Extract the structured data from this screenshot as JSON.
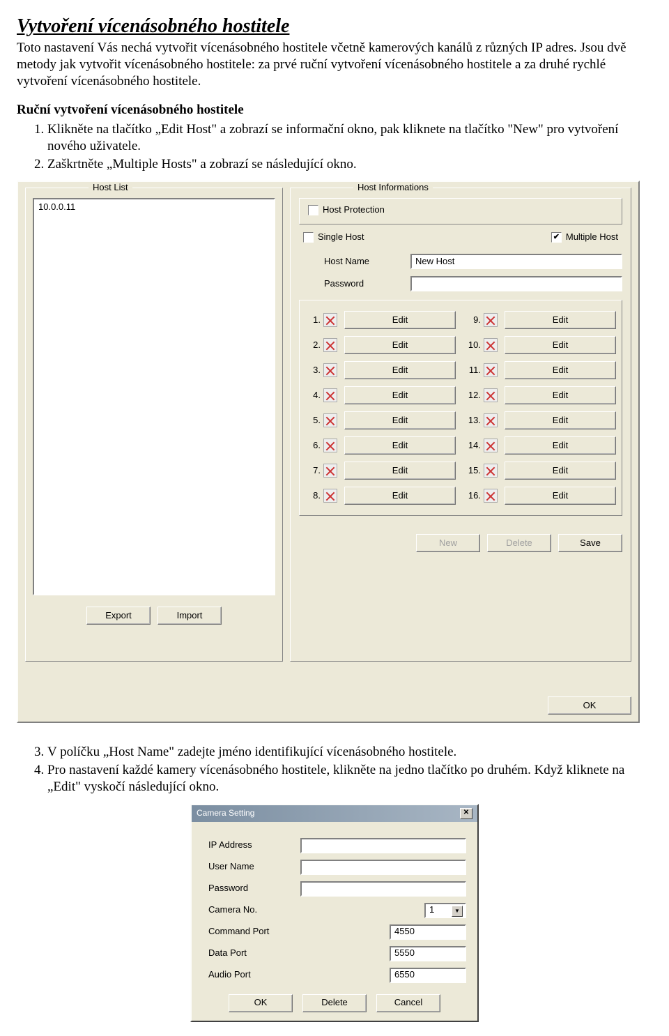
{
  "doc": {
    "title": "Vytvoření vícenásobného hostitele",
    "intro": "Toto nastavení Vás nechá vytvořit vícenásobného hostitele včetně kamerových kanálů z různých IP adres. Jsou dvě metody jak vytvořit vícenásobného hostitele: za prvé ruční vytvoření vícenásobného hostitele a za druhé rychlé vytvoření vícenásobného hostitele.",
    "subhead": "Ruční vytvoření vícenásobného hostitele",
    "step1": "Klikněte na tlačítko „Edit Host\" a zobrazí se informační okno, pak kliknete na tlačítko \"New\" pro vytvoření nového uživatele.",
    "step2": "Zaškrtněte „Multiple Hosts\" a zobrazí se následující okno.",
    "step3": "V políčku „Host Name\" zadejte jméno identifikující vícenásobného hostitele.",
    "step4": "Pro nastavení každé kamery vícenásobného hostitele, klikněte na jedno tlačítko po druhém. Když kliknete na „Edit\" vyskočí následující okno."
  },
  "hostlist": {
    "title": "Host List",
    "items": [
      "10.0.0.11"
    ],
    "export_btn": "Export",
    "import_btn": "Import"
  },
  "hostinfo": {
    "title": "Host Informations",
    "host_protection": "Host Protection",
    "single_host": "Single Host",
    "multiple_host": "Multiple Host",
    "hostname_label": "Host Name",
    "hostname_value": "New Host",
    "password_label": "Password",
    "edit_label": "Edit",
    "new_btn": "New",
    "delete_btn": "Delete",
    "save_btn": "Save",
    "ok_btn": "OK",
    "rows": [
      "1.",
      "2.",
      "3.",
      "4.",
      "5.",
      "6.",
      "7.",
      "8.",
      "9.",
      "10.",
      "11.",
      "12.",
      "13.",
      "14.",
      "15.",
      "16."
    ]
  },
  "camera": {
    "window_title": "Camera Setting",
    "ip_label": "IP Address",
    "user_label": "User Name",
    "pwd_label": "Password",
    "cam_no_label": "Camera No.",
    "cam_no_value": "1",
    "cmd_port_label": "Command Port",
    "cmd_port_value": "4550",
    "data_port_label": "Data Port",
    "data_port_value": "5550",
    "audio_port_label": "Audio Port",
    "audio_port_value": "6550",
    "ok_btn": "OK",
    "delete_btn": "Delete",
    "cancel_btn": "Cancel"
  }
}
